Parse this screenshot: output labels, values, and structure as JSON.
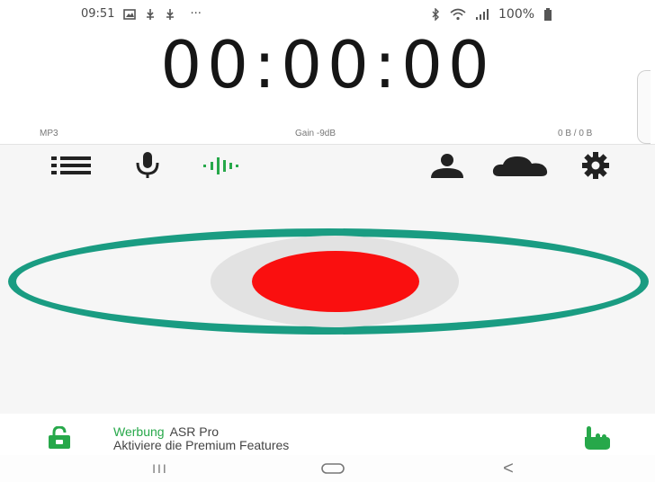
{
  "status_bar": {
    "time": "09:51",
    "more": "···",
    "battery": "100%",
    "icons": [
      "gallery-icon",
      "usb-icon",
      "usb-icon",
      "bluetooth-icon",
      "wifi-icon",
      "signal-icon",
      "battery-icon"
    ]
  },
  "timer": {
    "value": "00:00:00"
  },
  "info": {
    "format": "MP3",
    "gain": "Gain -9dB",
    "size": "0 B / 0 B"
  },
  "toolbar": {
    "icons": [
      "list-icon",
      "microphone-icon",
      "waveform-icon",
      "profile-icon",
      "cloud-icon",
      "gear-icon"
    ],
    "accent": "#27a84a"
  },
  "recorder": {
    "ring_color": "#1a9c82",
    "button_color": "#fa0f0f"
  },
  "ad": {
    "label": "Werbung",
    "app": "ASR Pro",
    "description": "Aktiviere die Premium Features",
    "icons": [
      "lock-open-icon",
      "hand-pointer-icon"
    ]
  },
  "nav": {
    "recents": "III",
    "back": "<",
    "icons": [
      "recents-icon",
      "home-icon",
      "back-icon"
    ]
  }
}
